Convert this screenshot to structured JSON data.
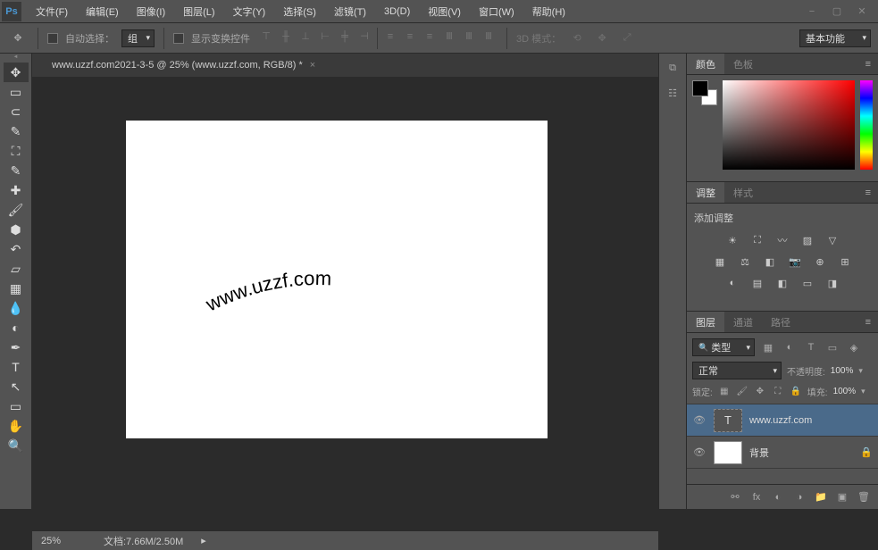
{
  "app": {
    "logo": "Ps"
  },
  "window": {
    "minimize": "−",
    "maximize": "▢",
    "close": "✕"
  },
  "menu": {
    "file": "文件(F)",
    "edit": "编辑(E)",
    "image": "图像(I)",
    "layer": "图层(L)",
    "type": "文字(Y)",
    "select": "选择(S)",
    "filter": "滤镜(T)",
    "threeD": "3D(D)",
    "view": "视图(V)",
    "window": "窗口(W)",
    "help": "帮助(H)"
  },
  "options": {
    "auto_select": "自动选择：",
    "group": "组",
    "show_transform": "显示变换控件",
    "mode_3d": "3D 模式：",
    "workspace": "基本功能"
  },
  "tabs": {
    "doc1": "www.uzzf.com2021-3-5 @ 25% (www.uzzf.com, RGB/8) *"
  },
  "canvas": {
    "text": "www.uzzf.com"
  },
  "panels": {
    "color": {
      "tab1": "颜色",
      "tab2": "色板",
      "fg": "#000000",
      "bg": "#ffffff"
    },
    "adjustments": {
      "tab1": "调整",
      "tab2": "样式",
      "label": "添加调整"
    },
    "layers": {
      "tab1": "图层",
      "tab2": "通道",
      "tab3": "路径",
      "filter_kind": "类型",
      "blend_mode": "正常",
      "opacity_label": "不透明度:",
      "opacity_value": "100%",
      "lock_label": "锁定:",
      "fill_label": "填充:",
      "fill_value": "100%",
      "items": [
        {
          "name": "www.uzzf.com",
          "type": "text",
          "visible": true,
          "selected": true,
          "locked": false
        },
        {
          "name": "背景",
          "type": "raster",
          "visible": true,
          "selected": false,
          "locked": true
        }
      ]
    }
  },
  "status": {
    "zoom": "25%",
    "doc_info": "文档:7.66M/2.50M"
  }
}
